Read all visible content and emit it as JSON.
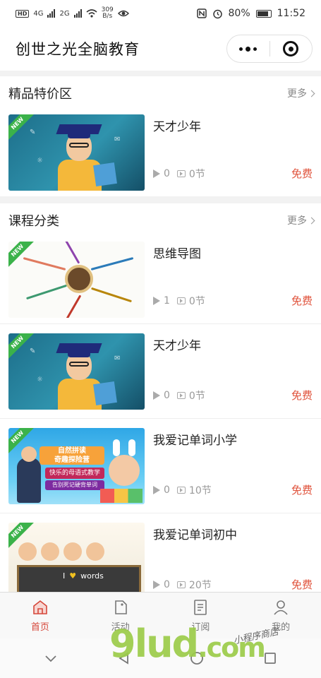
{
  "status": {
    "hd": "HD",
    "sig1": "4G",
    "sig2": "2G",
    "speed_num": "309",
    "speed_unit": "B/s",
    "battery": "80%",
    "time": "11:52"
  },
  "header": {
    "title": "创世之光全脑教育"
  },
  "featured": {
    "title": "精品特价区",
    "more": "更多",
    "items": [
      {
        "name": "天才少年",
        "plays": "0",
        "lessons": "0节",
        "price": "免费",
        "tag": "NEW"
      }
    ]
  },
  "categories": {
    "title": "课程分类",
    "more": "更多",
    "items": [
      {
        "name": "思维导图",
        "plays": "1",
        "lessons": "0节",
        "price": "免费",
        "tag": "NEW"
      },
      {
        "name": "天才少年",
        "plays": "0",
        "lessons": "0节",
        "price": "免费",
        "tag": "NEW"
      },
      {
        "name": "我爱记单词小学",
        "plays": "0",
        "lessons": "10节",
        "price": "免费",
        "tag": "NEW",
        "thumb_text": {
          "line1": "自然拼读",
          "line2": "奇趣探险营",
          "line3": "快乐的母语式教学",
          "line4": "告别死记硬背单词"
        }
      },
      {
        "name": "我爱记单词初中",
        "plays": "0",
        "lessons": "20节",
        "price": "免费",
        "tag": "NEW",
        "thumb_text": {
          "word1": "I",
          "word2": "words"
        }
      }
    ]
  },
  "tabbar": {
    "items": [
      {
        "label": "首页",
        "icon": "home-icon",
        "active": true
      },
      {
        "label": "活动",
        "icon": "tag-icon",
        "active": false
      },
      {
        "label": "订阅",
        "icon": "document-icon",
        "active": false
      },
      {
        "label": "我的",
        "icon": "user-icon",
        "active": false
      }
    ]
  },
  "watermark": {
    "brand": "9lud",
    "suffix": ".com",
    "caption": "小程序商店"
  },
  "colors": {
    "accent": "#d6473a",
    "price": "#e0533c",
    "new_tag": "#3bb24a"
  }
}
